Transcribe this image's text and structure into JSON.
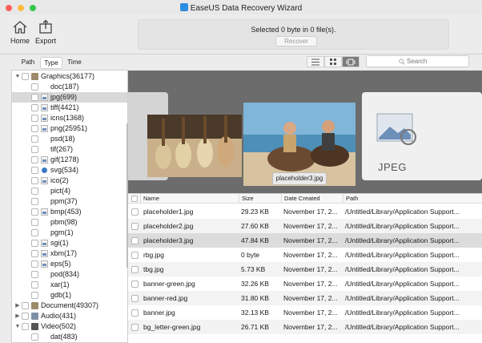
{
  "window": {
    "title": "EaseUS Data Recovery Wizard"
  },
  "toolbar": {
    "home_label": "Home",
    "export_label": "Export",
    "status_text": "Selected 0 byte in 0 file(s).",
    "recover_label": "Recover"
  },
  "left_tabs": [
    "Path",
    "Type",
    "Time"
  ],
  "tree": [
    {
      "label": "Graphics(36177)"
    },
    {
      "label": "doc(187)"
    },
    {
      "label": "jpg(699)"
    },
    {
      "label": "tiff(4421)"
    },
    {
      "label": "icns(1368)"
    },
    {
      "label": "png(25951)"
    },
    {
      "label": "psd(18)"
    },
    {
      "label": "tif(267)"
    },
    {
      "label": "gif(1278)"
    },
    {
      "label": "svg(534)"
    },
    {
      "label": "ico(2)"
    },
    {
      "label": "pict(4)"
    },
    {
      "label": "ppm(37)"
    },
    {
      "label": "bmp(453)"
    },
    {
      "label": "pbm(98)"
    },
    {
      "label": "pgm(1)"
    },
    {
      "label": "sgi(1)"
    },
    {
      "label": "xbm(17)"
    },
    {
      "label": "eps(5)"
    },
    {
      "label": "pod(834)"
    },
    {
      "label": "xar(1)"
    },
    {
      "label": "gdb(1)"
    },
    {
      "label": "Document(49307)"
    },
    {
      "label": "Audio(431)"
    },
    {
      "label": "Video(502)"
    },
    {
      "label": "dat(483)"
    }
  ],
  "search": {
    "placeholder": "Search"
  },
  "preview": {
    "caption": "placeholder3.jpg",
    "jpeg_label": "JPEG"
  },
  "table": {
    "columns": [
      "Name",
      "Size",
      "Date Created",
      "Path"
    ],
    "rows": [
      {
        "name": "placeholder1.jpg",
        "size": "29.23 KB",
        "date": "November 17, 2...",
        "path": "/Untitled/Library/Application Support..."
      },
      {
        "name": "placeholder2.jpg",
        "size": "27.60 KB",
        "date": "November 17, 2...",
        "path": "/Untitled/Library/Application Support..."
      },
      {
        "name": "placeholder3.jpg",
        "size": "47.84 KB",
        "date": "November 17, 2...",
        "path": "/Untitled/Library/Application Support..."
      },
      {
        "name": "rbg.jpg",
        "size": "0 byte",
        "date": "November 17, 2...",
        "path": "/Untitled/Library/Application Support..."
      },
      {
        "name": "tbg.jpg",
        "size": "5.73 KB",
        "date": "November 17, 2...",
        "path": "/Untitled/Library/Application Support..."
      },
      {
        "name": "banner-green.jpg",
        "size": "32.26 KB",
        "date": "November 17, 2...",
        "path": "/Untitled/Library/Application Support..."
      },
      {
        "name": "banner-red.jpg",
        "size": "31.80 KB",
        "date": "November 17, 2...",
        "path": "/Untitled/Library/Application Support..."
      },
      {
        "name": "banner.jpg",
        "size": "32.13 KB",
        "date": "November 17, 2...",
        "path": "/Untitled/Library/Application Support..."
      },
      {
        "name": "bg_letter-green.jpg",
        "size": "26.71 KB",
        "date": "November 17, 2...",
        "path": "/Untitled/Library/Application Support..."
      }
    ]
  }
}
